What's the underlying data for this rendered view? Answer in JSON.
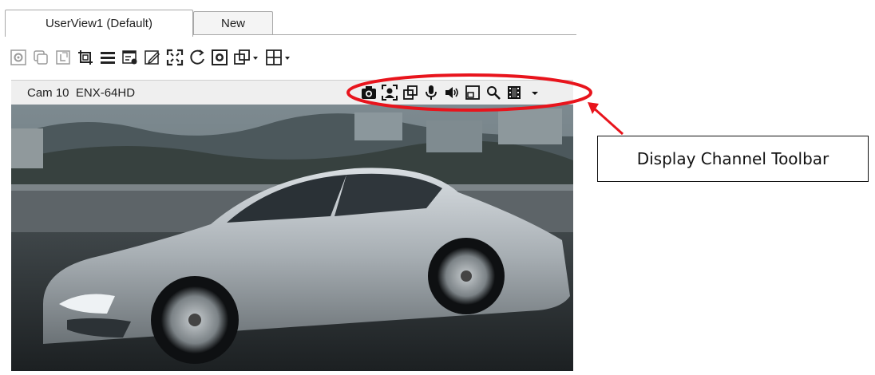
{
  "tabs": [
    {
      "label": "UserView1 (Default)",
      "active": true
    },
    {
      "label": "New",
      "active": false
    }
  ],
  "main_toolbar": {
    "icons": [
      "settings-icon",
      "copy-icon",
      "paste-icon",
      "crop-icon",
      "menu-icon",
      "list-icon",
      "edit-icon",
      "fullscreen-icon",
      "refresh-icon",
      "snapshot-icon",
      "window-dropdown-icon",
      "grid-dropdown-icon"
    ]
  },
  "channel": {
    "label": "Cam 10  ENX-64HD",
    "toolbar_icons": [
      "camera-icon",
      "face-icon",
      "window-icon",
      "microphone-icon",
      "speaker-icon",
      "layout-icon",
      "zoom-icon",
      "film-icon",
      "chevron-down-icon"
    ]
  },
  "annotation": {
    "label": "Display Channel Toolbar",
    "highlight_color": "#e8141c"
  },
  "colors": {
    "tab_border": "#a8a8a8",
    "toolbar_bg": "#efefef",
    "annotation_red": "#e8141c"
  }
}
